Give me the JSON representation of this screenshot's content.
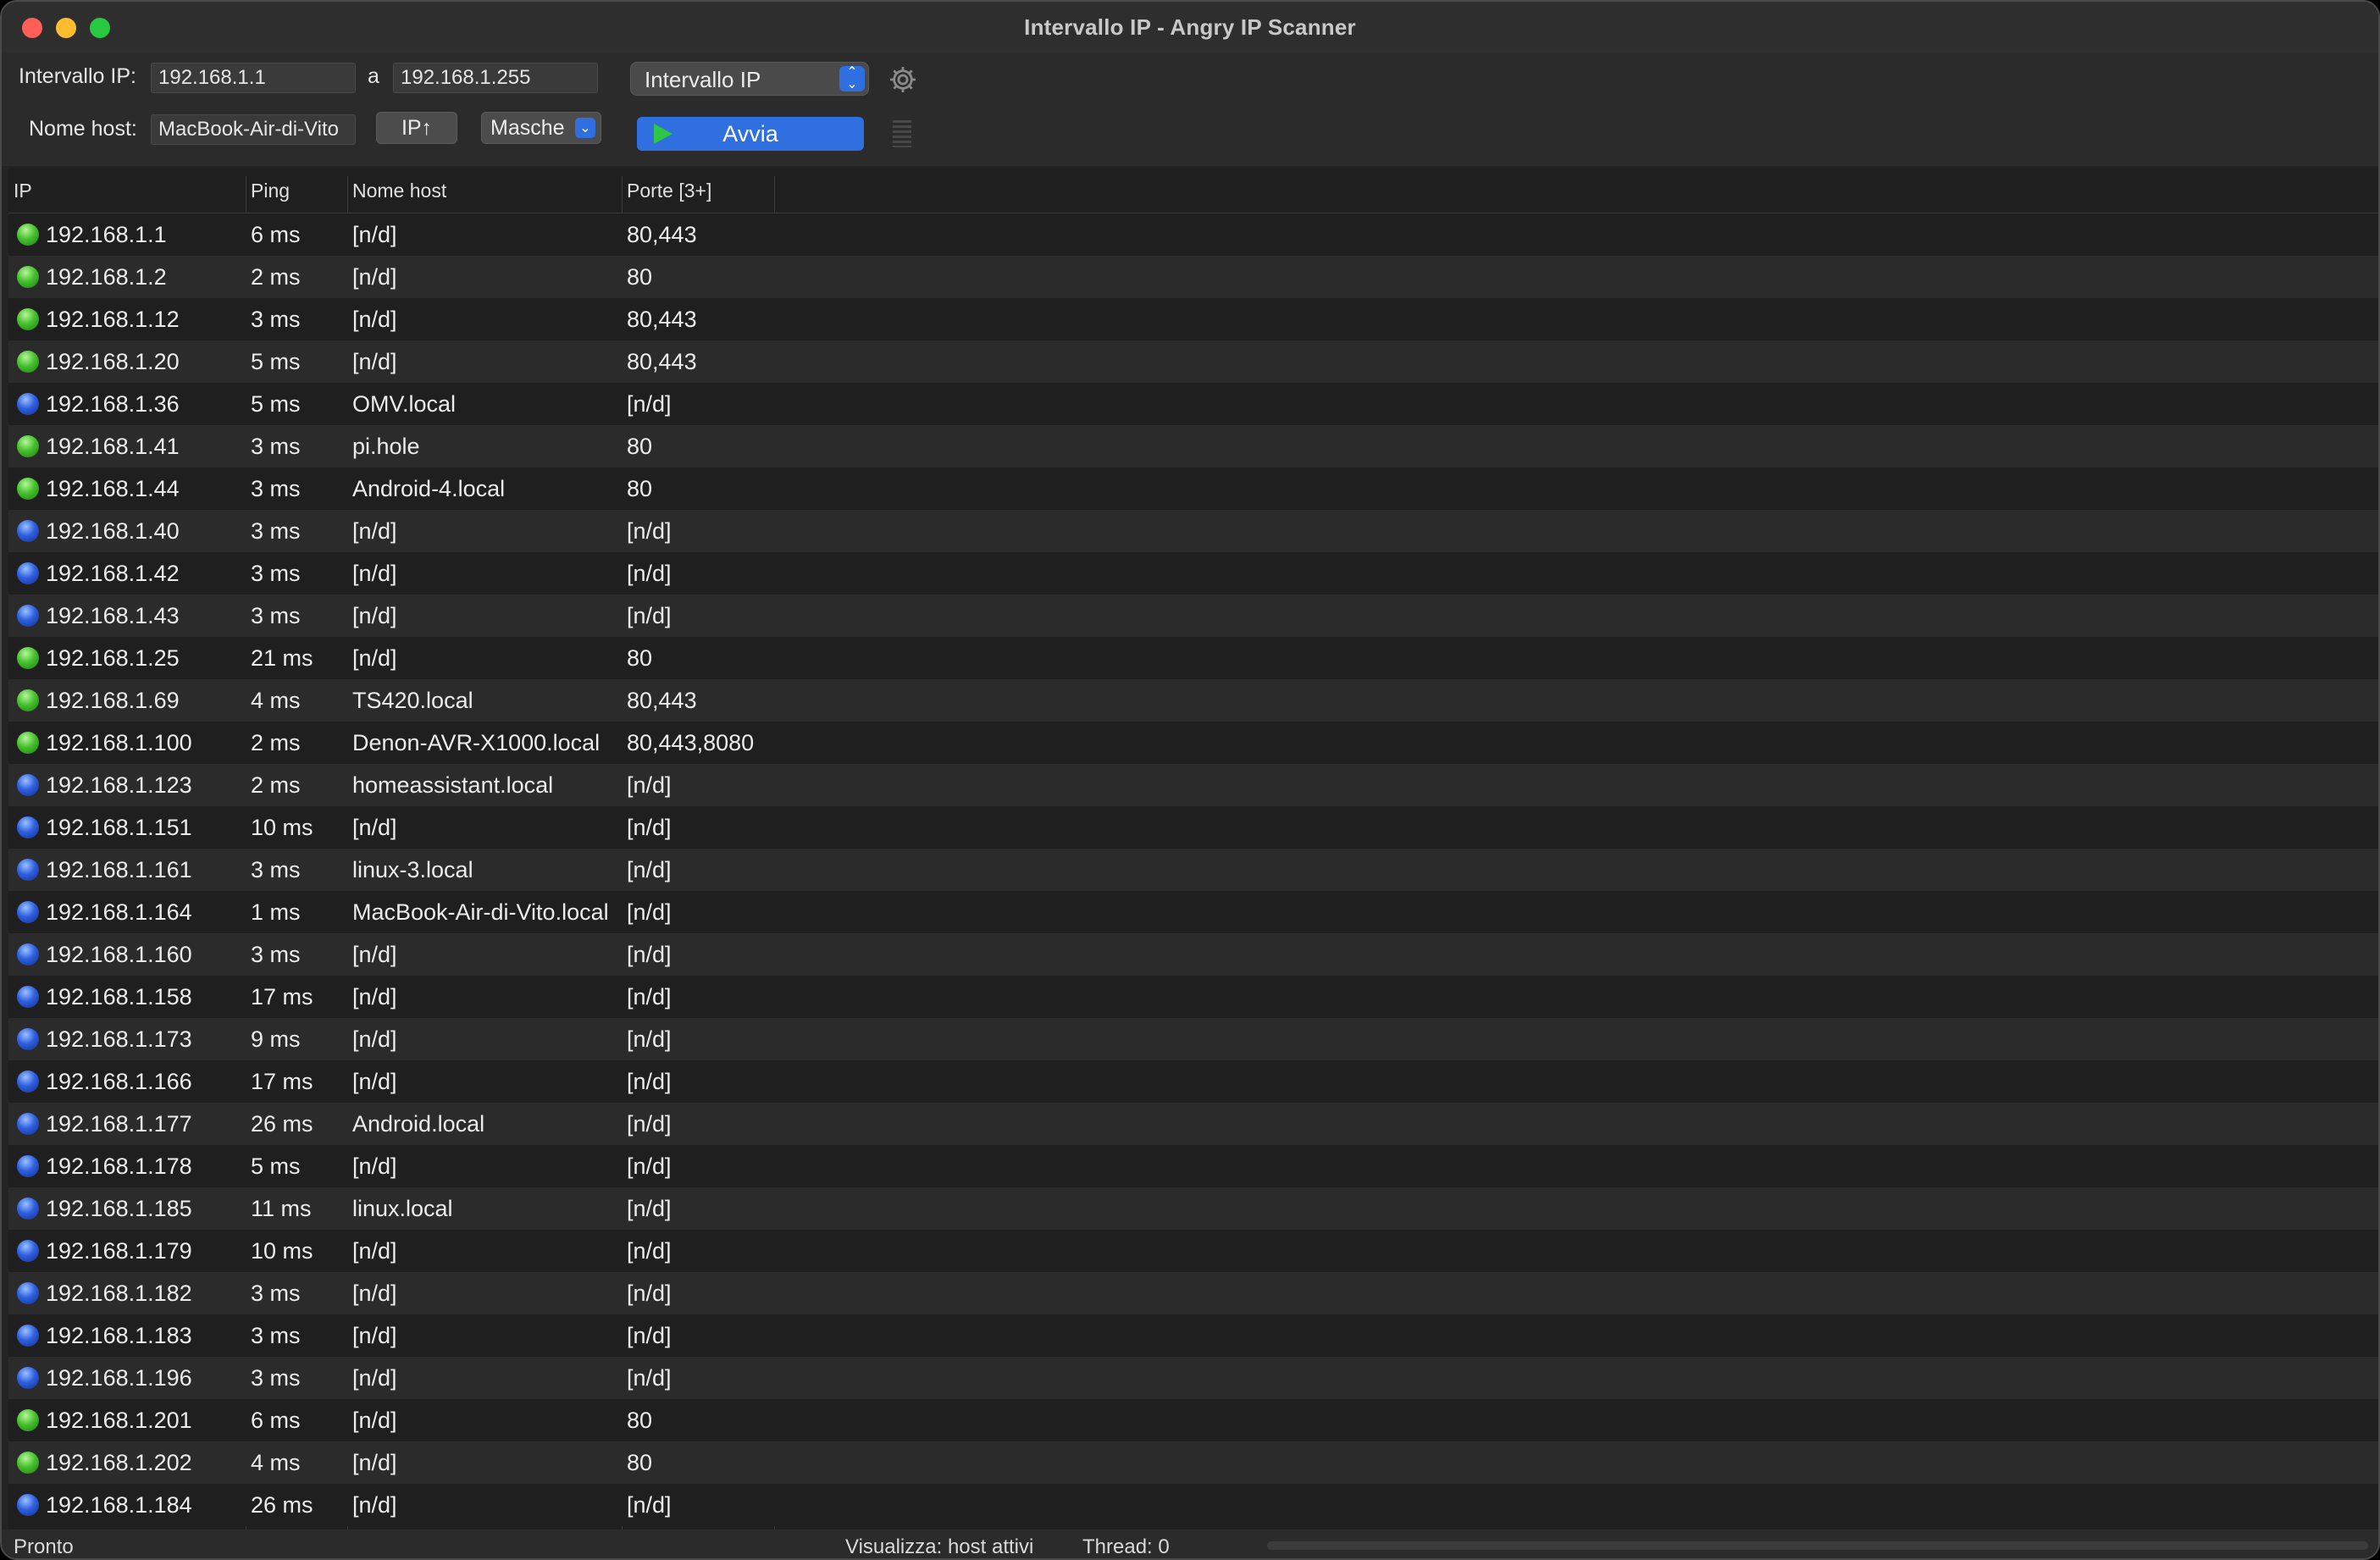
{
  "window": {
    "title": "Intervallo IP - Angry IP Scanner"
  },
  "toolbar": {
    "range_label": "Intervallo IP:",
    "start_ip": "192.168.1.1",
    "to_label": "a",
    "end_ip": "192.168.1.255",
    "feeder_select": "Intervallo IP",
    "hostname_label": "Nome host:",
    "hostname_value": "MacBook-Air-di-Vito",
    "ip_up_button": "IP↑",
    "masks_button": "Masche",
    "start_button": "Avvia"
  },
  "table": {
    "columns": [
      "IP",
      "Ping",
      "Nome host",
      "Porte [3+]"
    ],
    "rows": [
      {
        "status": "alive-open",
        "ip": "192.168.1.1",
        "ping": "6 ms",
        "host": "[n/d]",
        "ports": "80,443"
      },
      {
        "status": "alive-open",
        "ip": "192.168.1.2",
        "ping": "2 ms",
        "host": "[n/d]",
        "ports": "80"
      },
      {
        "status": "alive-open",
        "ip": "192.168.1.12",
        "ping": "3 ms",
        "host": "[n/d]",
        "ports": "80,443"
      },
      {
        "status": "alive-open",
        "ip": "192.168.1.20",
        "ping": "5 ms",
        "host": "[n/d]",
        "ports": "80,443"
      },
      {
        "status": "alive",
        "ip": "192.168.1.36",
        "ping": "5 ms",
        "host": "OMV.local",
        "ports": "[n/d]"
      },
      {
        "status": "alive-open",
        "ip": "192.168.1.41",
        "ping": "3 ms",
        "host": "pi.hole",
        "ports": "80"
      },
      {
        "status": "alive-open",
        "ip": "192.168.1.44",
        "ping": "3 ms",
        "host": "Android-4.local",
        "ports": "80"
      },
      {
        "status": "alive",
        "ip": "192.168.1.40",
        "ping": "3 ms",
        "host": "[n/d]",
        "ports": "[n/d]"
      },
      {
        "status": "alive",
        "ip": "192.168.1.42",
        "ping": "3 ms",
        "host": "[n/d]",
        "ports": "[n/d]"
      },
      {
        "status": "alive",
        "ip": "192.168.1.43",
        "ping": "3 ms",
        "host": "[n/d]",
        "ports": "[n/d]"
      },
      {
        "status": "alive-open",
        "ip": "192.168.1.25",
        "ping": "21 ms",
        "host": "[n/d]",
        "ports": "80"
      },
      {
        "status": "alive-open",
        "ip": "192.168.1.69",
        "ping": "4 ms",
        "host": "TS420.local",
        "ports": "80,443"
      },
      {
        "status": "alive-open",
        "ip": "192.168.1.100",
        "ping": "2 ms",
        "host": "Denon-AVR-X1000.local",
        "ports": "80,443,8080"
      },
      {
        "status": "alive",
        "ip": "192.168.1.123",
        "ping": "2 ms",
        "host": "homeassistant.local",
        "ports": "[n/d]"
      },
      {
        "status": "alive",
        "ip": "192.168.1.151",
        "ping": "10 ms",
        "host": "[n/d]",
        "ports": "[n/d]"
      },
      {
        "status": "alive",
        "ip": "192.168.1.161",
        "ping": "3 ms",
        "host": "linux-3.local",
        "ports": "[n/d]"
      },
      {
        "status": "alive",
        "ip": "192.168.1.164",
        "ping": "1 ms",
        "host": "MacBook-Air-di-Vito.local",
        "ports": "[n/d]"
      },
      {
        "status": "alive",
        "ip": "192.168.1.160",
        "ping": "3 ms",
        "host": "[n/d]",
        "ports": "[n/d]"
      },
      {
        "status": "alive",
        "ip": "192.168.1.158",
        "ping": "17 ms",
        "host": "[n/d]",
        "ports": "[n/d]"
      },
      {
        "status": "alive",
        "ip": "192.168.1.173",
        "ping": "9 ms",
        "host": "[n/d]",
        "ports": "[n/d]"
      },
      {
        "status": "alive",
        "ip": "192.168.1.166",
        "ping": "17 ms",
        "host": "[n/d]",
        "ports": "[n/d]"
      },
      {
        "status": "alive",
        "ip": "192.168.1.177",
        "ping": "26 ms",
        "host": "Android.local",
        "ports": "[n/d]"
      },
      {
        "status": "alive",
        "ip": "192.168.1.178",
        "ping": "5 ms",
        "host": "[n/d]",
        "ports": "[n/d]"
      },
      {
        "status": "alive",
        "ip": "192.168.1.185",
        "ping": "11 ms",
        "host": "linux.local",
        "ports": "[n/d]"
      },
      {
        "status": "alive",
        "ip": "192.168.1.179",
        "ping": "10 ms",
        "host": "[n/d]",
        "ports": "[n/d]"
      },
      {
        "status": "alive",
        "ip": "192.168.1.182",
        "ping": "3 ms",
        "host": "[n/d]",
        "ports": "[n/d]"
      },
      {
        "status": "alive",
        "ip": "192.168.1.183",
        "ping": "3 ms",
        "host": "[n/d]",
        "ports": "[n/d]"
      },
      {
        "status": "alive",
        "ip": "192.168.1.196",
        "ping": "3 ms",
        "host": "[n/d]",
        "ports": "[n/d]"
      },
      {
        "status": "alive-open",
        "ip": "192.168.1.201",
        "ping": "6 ms",
        "host": "[n/d]",
        "ports": "80"
      },
      {
        "status": "alive-open",
        "ip": "192.168.1.202",
        "ping": "4 ms",
        "host": "[n/d]",
        "ports": "80"
      },
      {
        "status": "alive",
        "ip": "192.168.1.184",
        "ping": "26 ms",
        "host": "[n/d]",
        "ports": "[n/d]"
      }
    ]
  },
  "statusbar": {
    "state": "Pronto",
    "display": "Visualizza: host attivi",
    "threads": "Thread: 0"
  },
  "colors": {
    "accent": "#2f6fe0",
    "alive_open": "#45c12d",
    "alive": "#2f5fe0"
  }
}
